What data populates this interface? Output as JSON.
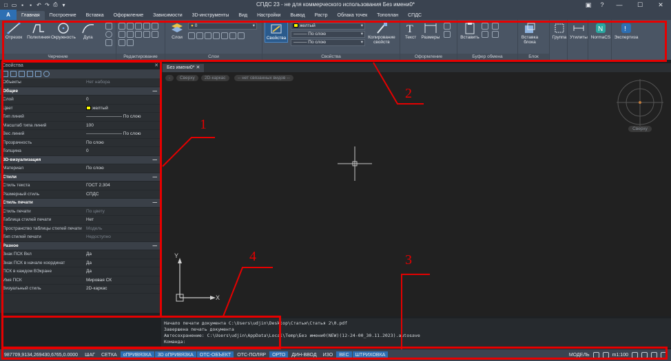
{
  "window": {
    "title": "СПДС 23 - не для коммерческого использования Без имени0*",
    "logo_letter": "A",
    "help_glyph": "?",
    "user_glyph": "▣"
  },
  "ribbon_tabs": [
    "Главная",
    "Построение",
    "Вставка",
    "Оформление",
    "Зависимости",
    "3D-инструменты",
    "Вид",
    "Настройки",
    "Вывод",
    "Растр",
    "Облака точек",
    "Топоплан",
    "СПДС"
  ],
  "active_tab_index": 0,
  "ribbon": {
    "draw": {
      "name": "Черчение",
      "items": [
        "Отрезок",
        "Полилиния",
        "Окружность",
        "Дуга"
      ]
    },
    "modify": {
      "name": "Редактирование"
    },
    "layers": {
      "name": "Слои",
      "layer_button": "Слои",
      "layer_current": "0"
    },
    "properties": {
      "name": "Свойства",
      "button": "Свойства",
      "color": "желтый",
      "linetype": "По слою",
      "lineweight": "По слою",
      "copy_props": "Копирование свойств"
    },
    "annotation": {
      "name": "Оформление",
      "items": [
        "Текст",
        "Размеры"
      ]
    },
    "clipboard": {
      "name": "Буфер обмена",
      "paste": "Вставить"
    },
    "block": {
      "name": "Блок",
      "insert": "Вставка блока"
    },
    "group": {
      "label": "Группа"
    },
    "utilities": {
      "label": "Утилиты"
    },
    "nanocad": {
      "label": "NormaCS"
    },
    "expert": {
      "label": "Экспертиза"
    }
  },
  "palette": {
    "title": "Свойства",
    "rows": [
      {
        "k": "Объекты",
        "v": "Нет набора",
        "dim": true
      },
      {
        "cat": "Общие"
      },
      {
        "k": "Слой",
        "v": "0"
      },
      {
        "k": "Цвет",
        "v": "желтый",
        "swatch": true
      },
      {
        "k": "Тип линий",
        "v": "———————— По слою"
      },
      {
        "k": "Масштаб типа линий",
        "v": "100"
      },
      {
        "k": "Вес линий",
        "v": "———————— По слою"
      },
      {
        "k": "Прозрачность",
        "v": "По слою"
      },
      {
        "k": "Толщина",
        "v": "0"
      },
      {
        "cat": "3D-визуализация"
      },
      {
        "k": "Материал",
        "v": "По слою"
      },
      {
        "cat": "Стили"
      },
      {
        "k": "Стиль текста",
        "v": "ГОСТ 2.304"
      },
      {
        "k": "Размерный стиль",
        "v": "СПДС"
      },
      {
        "cat": "Стиль печати"
      },
      {
        "k": "Стиль печати",
        "v": "По цвету",
        "dim": true
      },
      {
        "k": "Таблица стилей печати",
        "v": "Нет"
      },
      {
        "k": "Пространство таблицы стилей печати",
        "v": "Модель",
        "dim": true
      },
      {
        "k": "Тип стилей печати",
        "v": "Недоступно",
        "dim": true
      },
      {
        "cat": "Разное"
      },
      {
        "k": "Знак ПСК Вкл",
        "v": "Да"
      },
      {
        "k": "Знак ПСК в начале координат",
        "v": "Да"
      },
      {
        "k": "ПСК в каждом ВЭкране",
        "v": "Да"
      },
      {
        "k": "Имя ПСК",
        "v": "Мировая СК"
      },
      {
        "k": "Визуальный стиль",
        "v": "2D-каркас"
      }
    ]
  },
  "document_tab": "Без имени0*",
  "view_labels": [
    "-",
    "Сверху",
    "2D-каркас",
    "-- нет связанных видов --"
  ],
  "compass_label": "Сверху",
  "ucs": {
    "x": "X",
    "y": "Y"
  },
  "command": {
    "lines": [
      "Начало печати документа C:\\Users\\udjin\\Desktop\\Статьи\\Статья 2\\0.pdf",
      "Завершена печать документа",
      "Автосохранение: C:\\Users\\udjin\\AppData\\Local\\Temp\\Без имени0(NEW)(12-24-00_30.11.2023).autosave",
      "Команда:"
    ]
  },
  "status": {
    "coords": "987709,9134,269430,6765,0.0000",
    "buttons": [
      {
        "label": "ШАГ",
        "on": false
      },
      {
        "label": "СЕТКА",
        "on": false
      },
      {
        "label": "оПРИВЯЗКА",
        "on": true
      },
      {
        "label": "3D оПРИВЯЗКА",
        "on": true
      },
      {
        "label": "ОТС-ОБЪЕКТ",
        "on": true
      },
      {
        "label": "ОТС-ПОЛЯР",
        "on": false
      },
      {
        "label": "ОРТО",
        "on": true
      },
      {
        "label": "ДИН-ВВОД",
        "on": false
      },
      {
        "label": "ИЗО",
        "on": false
      },
      {
        "label": "ВЕС",
        "on": true
      },
      {
        "label": "ШТРИХОВКА",
        "on": true
      }
    ],
    "model": "МОДЕЛЬ",
    "scale": "m1:100"
  },
  "annotations": [
    {
      "n": "1"
    },
    {
      "n": "2"
    },
    {
      "n": "3"
    },
    {
      "n": "4"
    }
  ],
  "colors": {
    "annotation": "#e60000",
    "accent": "#2d6fb3",
    "layer_color": "#ffff00"
  }
}
